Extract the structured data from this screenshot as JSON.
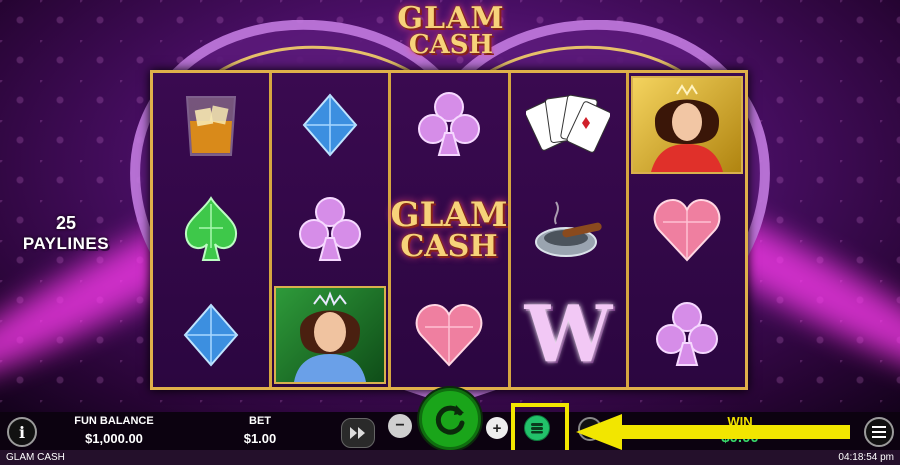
{
  "game": {
    "logo_line1": "GLAM",
    "logo_line2": "CASH",
    "paylines_count": "25",
    "paylines_label": "PAYLINES"
  },
  "reels": [
    [
      "whiskey-glass",
      "green-spade-gem",
      "blue-diamond-gem"
    ],
    [
      "blue-diamond-gem",
      "pink-club-gem",
      "green-lady-portrait"
    ],
    [
      "pink-club-gem",
      "glam-cash-logo",
      "pink-heart-gem"
    ],
    [
      "playing-cards",
      "cigar-ashtray",
      "wild-w"
    ],
    [
      "gold-lady-portrait",
      "pink-heart-gem",
      "pink-club-gem"
    ]
  ],
  "wild_letter": "W",
  "bottom_bar": {
    "fun_balance_label": "FUN BALANCE",
    "fun_balance_value": "$1,000.00",
    "bet_label": "BET",
    "bet_value": "$1.00",
    "minus": "−",
    "plus": "+",
    "win_label": "WIN",
    "win_value": "$0.00",
    "info": "i"
  },
  "status_bar": {
    "title": "GLAM CASH",
    "time": "04:18:54 pm"
  },
  "colors": {
    "highlight": "#f2e600",
    "spin": "#1aa51a",
    "reel_frame": "#e0b04a"
  }
}
